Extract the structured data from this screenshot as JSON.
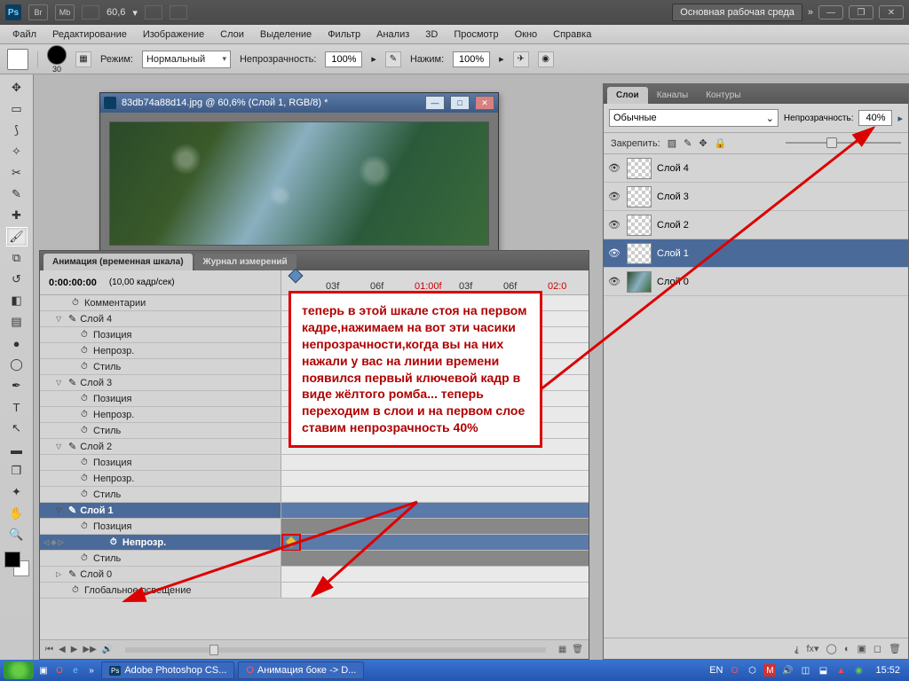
{
  "appbar": {
    "ps": "Ps",
    "br": "Br",
    "mb": "Mb",
    "zoom": "60,6",
    "workspace": "Основная рабочая среда",
    "chev": "»"
  },
  "menu": [
    "Файл",
    "Редактирование",
    "Изображение",
    "Слои",
    "Выделение",
    "Фильтр",
    "Анализ",
    "3D",
    "Просмотр",
    "Окно",
    "Справка"
  ],
  "opt": {
    "size": "30",
    "mode_lbl": "Режим:",
    "mode_val": "Нормальный",
    "opac_lbl": "Непрозрачность:",
    "opac_val": "100%",
    "flow_lbl": "Нажим:",
    "flow_val": "100%"
  },
  "doc": {
    "title": "83db74a88d14.jpg @ 60,6% (Слой 1, RGB/8) *"
  },
  "anim": {
    "tab1": "Анимация (временная шкала)",
    "tab2": "Журнал измерений",
    "time": "0:00:00:00",
    "fps": "(10,00 кадр/сек)",
    "ticks": [
      {
        "l": "03f",
        "p": 50
      },
      {
        "l": "06f",
        "p": 100
      },
      {
        "l": "01:00f",
        "p": 150,
        "red": true
      },
      {
        "l": "03f",
        "p": 200
      },
      {
        "l": "06f",
        "p": 250
      },
      {
        "l": "02:0",
        "p": 300,
        "red": true
      }
    ],
    "rows": [
      {
        "type": "comment",
        "label": "Комментарии",
        "indent": 28,
        "sw": "⏱"
      },
      {
        "type": "layer",
        "label": "Слой 4",
        "indent": 10,
        "tw": "▽",
        "br": "✎"
      },
      {
        "type": "prop",
        "label": "Позиция",
        "indent": 38,
        "sw": "⏱"
      },
      {
        "type": "prop",
        "label": "Непрозр.",
        "indent": 38,
        "sw": "⏱"
      },
      {
        "type": "prop",
        "label": "Стиль",
        "indent": 38,
        "sw": "⏱"
      },
      {
        "type": "layer",
        "label": "Слой 3",
        "indent": 10,
        "tw": "▽",
        "br": "✎"
      },
      {
        "type": "prop",
        "label": "Позиция",
        "indent": 38,
        "sw": "⏱"
      },
      {
        "type": "prop",
        "label": "Непрозр.",
        "indent": 38,
        "sw": "⏱"
      },
      {
        "type": "prop",
        "label": "Стиль",
        "indent": 38,
        "sw": "⏱"
      },
      {
        "type": "layer",
        "label": "Слой 2",
        "indent": 10,
        "tw": "▽",
        "br": "✎"
      },
      {
        "type": "prop",
        "label": "Позиция",
        "indent": 38,
        "sw": "⏱"
      },
      {
        "type": "prop",
        "label": "Непрозр.",
        "indent": 38,
        "sw": "⏱"
      },
      {
        "type": "prop",
        "label": "Стиль",
        "indent": 38,
        "sw": "⏱"
      },
      {
        "type": "layer",
        "label": "Слой 1",
        "indent": 10,
        "tw": "▽",
        "br": "✎",
        "dark": true,
        "selhdr": true
      },
      {
        "type": "prop",
        "label": "Позиция",
        "indent": 38,
        "sw": "⏱",
        "dark": true
      },
      {
        "type": "prop",
        "label": "Непрозр.",
        "indent": 38,
        "sw": "⏱",
        "dark": true,
        "sel": true,
        "kf": true,
        "nav": true
      },
      {
        "type": "prop",
        "label": "Стиль",
        "indent": 38,
        "sw": "⏱",
        "dark": true
      },
      {
        "type": "layer",
        "label": "Слой 0",
        "indent": 10,
        "tw": "▷",
        "br": "✎"
      },
      {
        "type": "global",
        "label": "Глобальное освещение",
        "indent": 28,
        "sw": "⏱"
      }
    ]
  },
  "layers": {
    "tab1": "Слои",
    "tab2": "Каналы",
    "tab3": "Контуры",
    "blend": "Обычные",
    "opac_lbl": "Непрозрачность:",
    "opac_val": "40%",
    "lock_lbl": "Закрепить:",
    "items": [
      {
        "name": "Слой 4"
      },
      {
        "name": "Слой 3"
      },
      {
        "name": "Слой 2"
      },
      {
        "name": "Слой 1",
        "sel": true
      },
      {
        "name": "Слой 0",
        "img": true
      }
    ]
  },
  "annot": "теперь в этой шкале стоя на первом кадре,нажимаем на вот эти часики непрозрачности,когда вы на них нажали у вас на линии времени появился первый ключевой кадр в виде жёлтого ромба... теперь переходим в слои и на первом слое ставим непрозрачность  40%",
  "taskbar": {
    "app1": "Adobe Photoshop CS...",
    "app2": "Анимация боке -> D...",
    "lang": "EN",
    "clock": "15:52"
  }
}
